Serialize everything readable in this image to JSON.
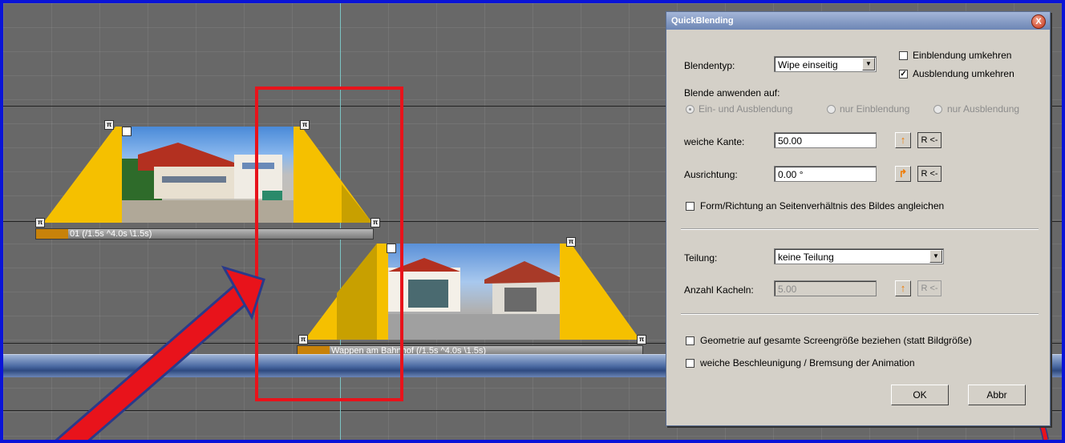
{
  "timeline": {
    "clip1": {
      "label": "01 (/1.5s ^4.0s \\1.5s)"
    },
    "clip2": {
      "label": "Wappen am Bahnhof (/1.5s ^4.0s \\1.5s)"
    }
  },
  "dialog": {
    "title": "QuickBlending",
    "close_symbol": "X",
    "blend_type_label": "Blendentyp:",
    "blend_type_value": "Wipe einseitig",
    "invert_in_label": "Einblendung umkehren",
    "invert_in_checked": false,
    "invert_out_label": "Ausblendung umkehren",
    "invert_out_checked": true,
    "apply_to_label": "Blende anwenden auf:",
    "radio_both": "Ein- und Ausblendung",
    "radio_in_only": "nur Einblendung",
    "radio_out_only": "nur Ausblendung",
    "soft_edge_label": "weiche Kante:",
    "soft_edge_value": "50.00",
    "orientation_label": "Ausrichtung:",
    "orientation_value": "0.00 °",
    "reset_label": "R <-",
    "aspect_label": "Form/Richtung an Seitenverhältnis des Bildes angleichen",
    "split_label": "Teilung:",
    "split_value": "keine Teilung",
    "tiles_label": "Anzahl Kacheln:",
    "tiles_value": "5.00",
    "geometry_label": "Geometrie auf gesamte Screengröße beziehen (statt Bildgröße)",
    "ease_label": "weiche Beschleunigung / Bremsung der Animation",
    "ok_label": "OK",
    "cancel_label": "Abbr"
  },
  "colors": {
    "accent_red": "#e8131b",
    "frame_blue": "#0a14d8",
    "fade_yellow": "#f5c000"
  }
}
